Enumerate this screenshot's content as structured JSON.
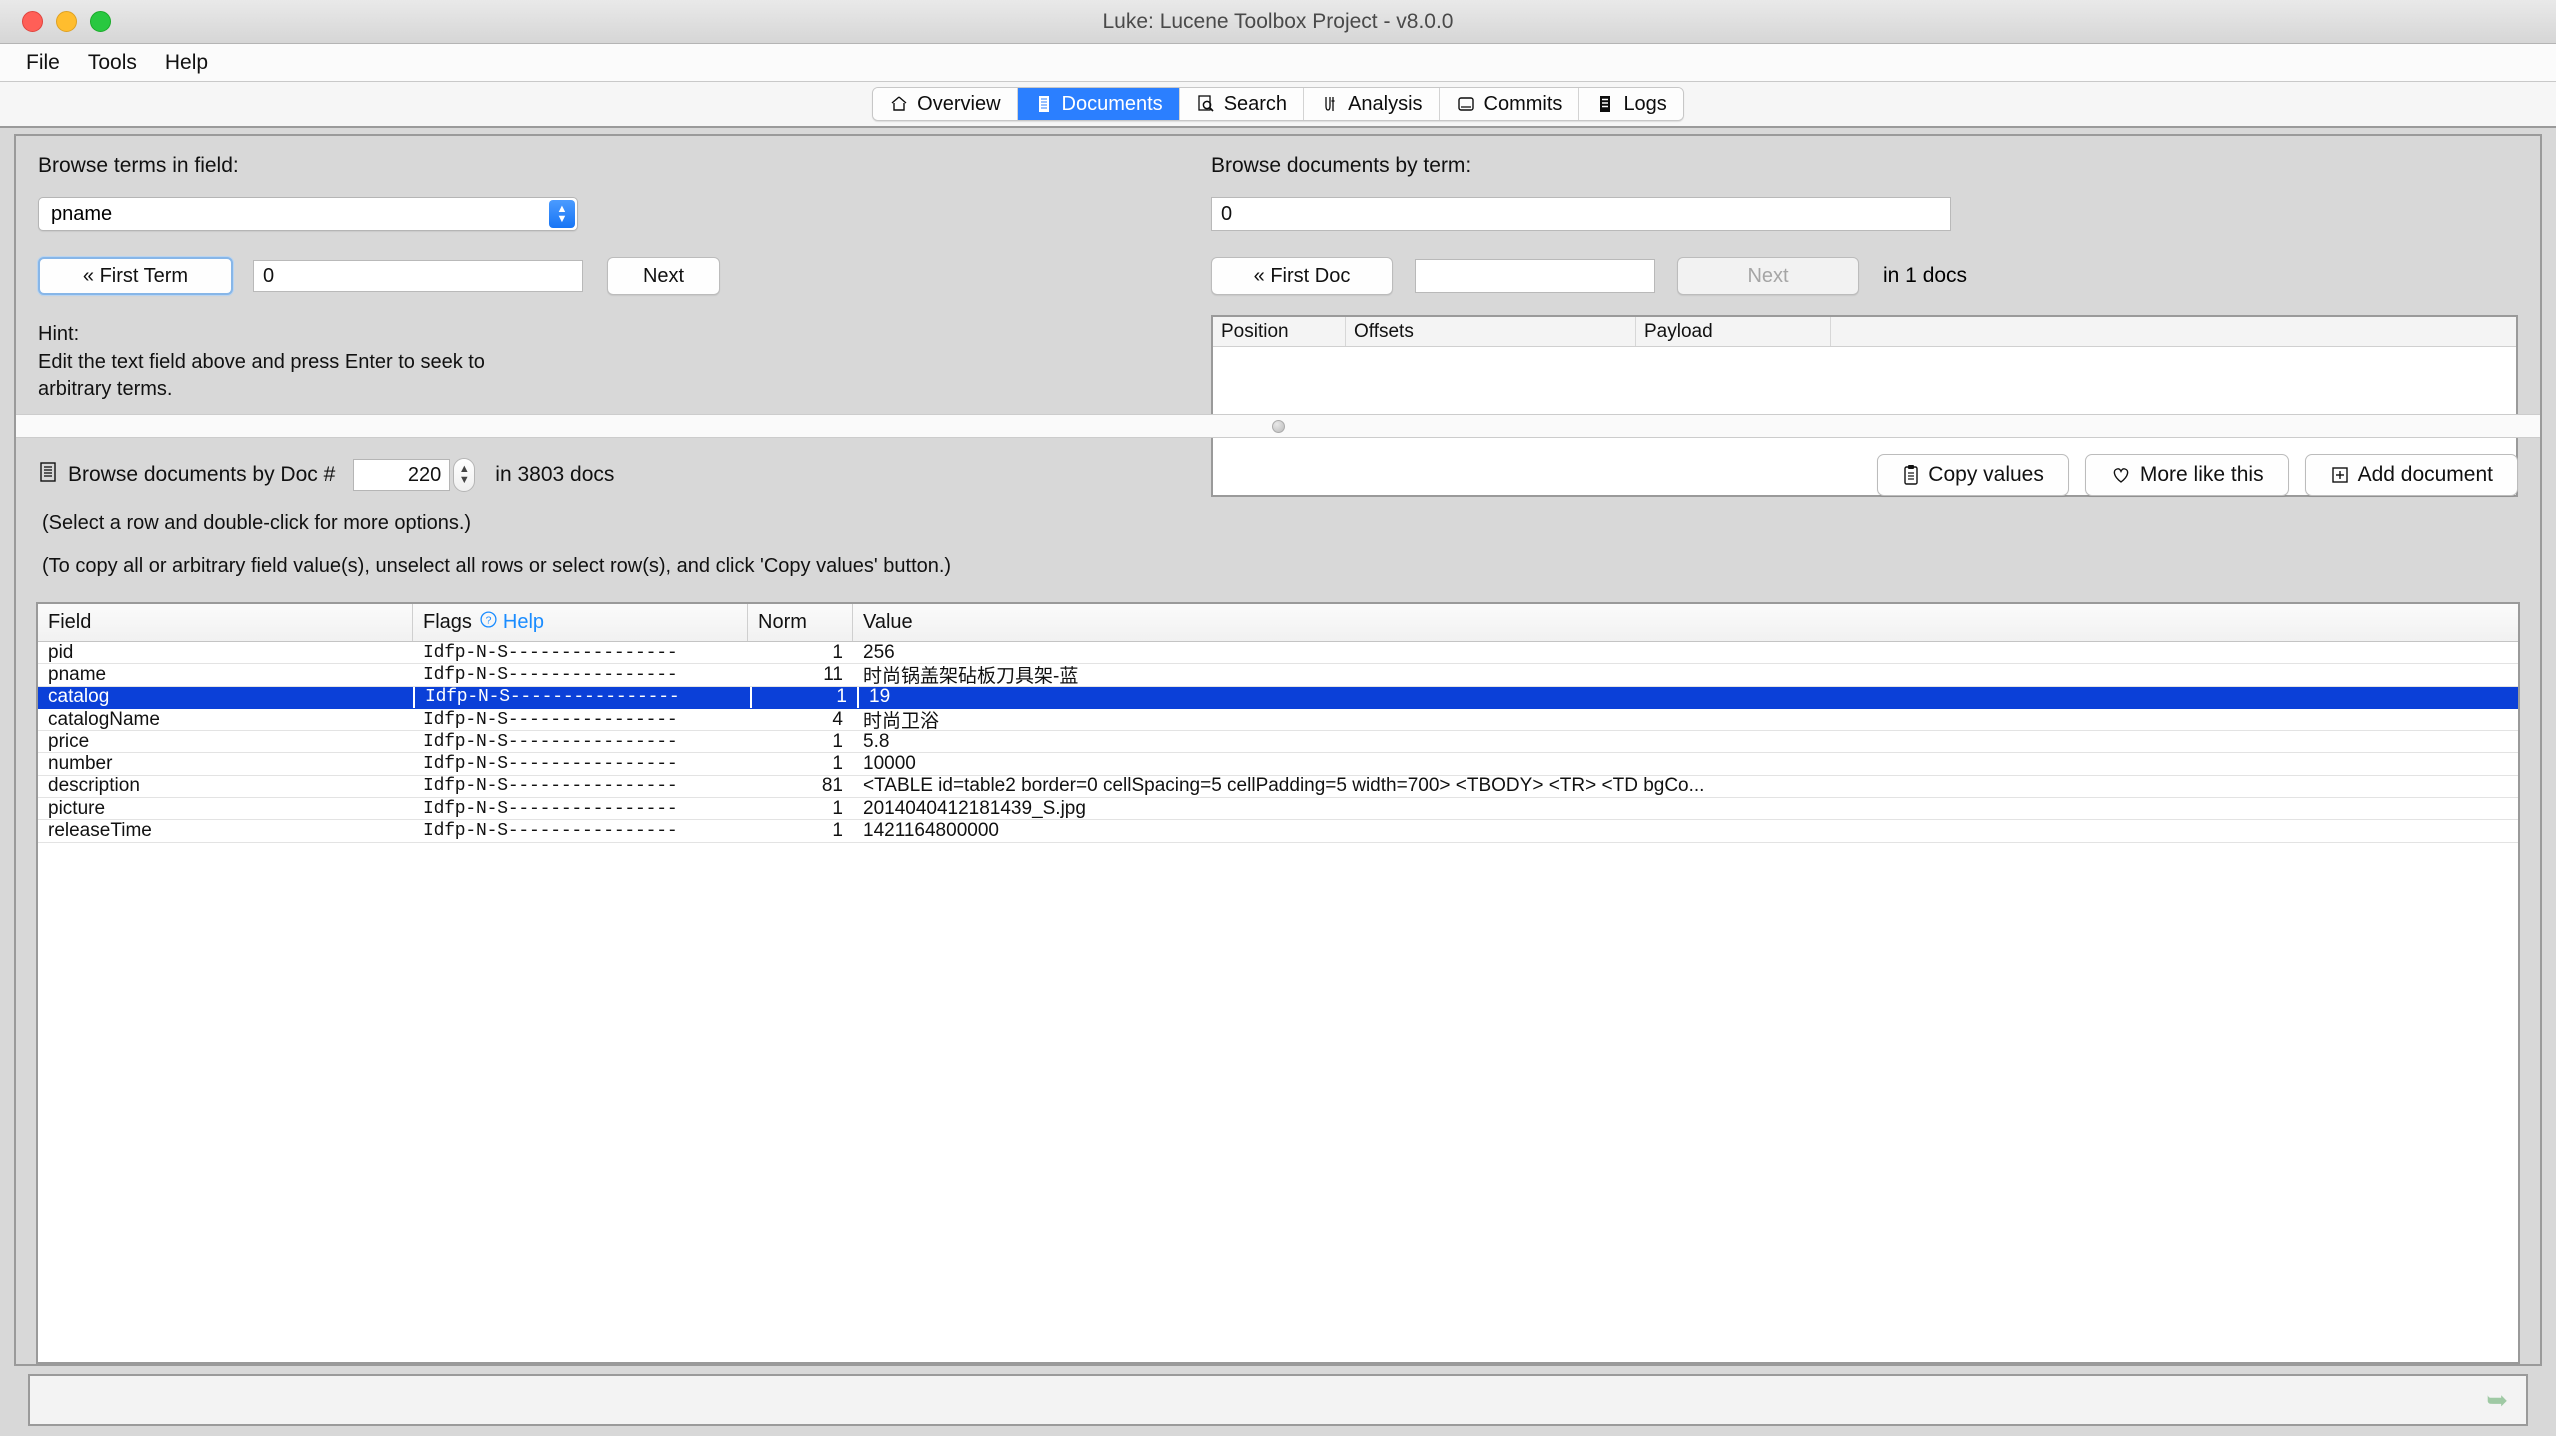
{
  "window": {
    "title": "Luke: Lucene Toolbox Project - v8.0.0",
    "traffic": {
      "close": "close-button",
      "minimize": "minimize-button",
      "zoom": "zoom-button"
    }
  },
  "menubar": {
    "items": [
      {
        "label": "File"
      },
      {
        "label": "Tools"
      },
      {
        "label": "Help"
      }
    ]
  },
  "tabs": [
    {
      "label": "Overview",
      "icon": "home-icon",
      "active": false
    },
    {
      "label": "Documents",
      "icon": "document-icon",
      "active": true
    },
    {
      "label": "Search",
      "icon": "search-icon",
      "active": false
    },
    {
      "label": "Analysis",
      "icon": "analysis-icon",
      "active": false
    },
    {
      "label": "Commits",
      "icon": "commits-icon",
      "active": false
    },
    {
      "label": "Logs",
      "icon": "logs-icon",
      "active": false
    }
  ],
  "browse_terms": {
    "label": "Browse terms in field:",
    "field_value": "pname",
    "first_term_button": "« First Term",
    "term_value": "0",
    "next_button": "Next",
    "hint_title": "Hint:",
    "hint_line1": "Edit the text field above and press Enter to seek to",
    "hint_line2": "arbitrary terms."
  },
  "browse_docs_by_term": {
    "label": "Browse documents by term:",
    "term_value": "0",
    "first_doc_button": "« First Doc",
    "doc_value": "",
    "next_button": "Next",
    "count_text": "in 1 docs",
    "payload_table": {
      "columns": [
        "Position",
        "Offsets",
        "Payload",
        ""
      ],
      "rows": []
    }
  },
  "doc_browser": {
    "label": "Browse documents by Doc #",
    "doc_number": "220",
    "total_text": "in 3803 docs",
    "buttons": [
      {
        "label": "Copy values",
        "icon": "clipboard-icon"
      },
      {
        "label": "More like this",
        "icon": "heart-icon"
      },
      {
        "label": "Add document",
        "icon": "plus-box-icon"
      }
    ]
  },
  "notes": {
    "line1": "(Select a row and double-click for more options.)",
    "line2": "(To copy all or arbitrary field value(s), unselect all rows or select row(s), and click 'Copy values' button.)"
  },
  "field_table": {
    "columns": [
      "Field",
      "Flags",
      "Norm",
      "Value"
    ],
    "help_label": "Help",
    "help_icon": "question-circle-icon",
    "rows": [
      {
        "field": "pid",
        "flags": "Idfp-N-S----------------",
        "norm": "1",
        "value": "256",
        "selected": false
      },
      {
        "field": "pname",
        "flags": "Idfp-N-S----------------",
        "norm": "11",
        "value": "时尚锅盖架砧板刀具架-蓝",
        "selected": false
      },
      {
        "field": "catalog",
        "flags": "Idfp-N-S----------------",
        "norm": "1",
        "value": "19",
        "selected": true
      },
      {
        "field": "catalogName",
        "flags": "Idfp-N-S----------------",
        "norm": "4",
        "value": "时尚卫浴",
        "selected": false
      },
      {
        "field": "price",
        "flags": "Idfp-N-S----------------",
        "norm": "1",
        "value": "5.8",
        "selected": false
      },
      {
        "field": "number",
        "flags": "Idfp-N-S----------------",
        "norm": "1",
        "value": "10000",
        "selected": false
      },
      {
        "field": "description",
        "flags": "Idfp-N-S----------------",
        "norm": "81",
        "value": "<TABLE id=table2 border=0 cellSpacing=5 cellPadding=5 width=700>  <TBODY>  <TR>  <TD bgCo...",
        "selected": false
      },
      {
        "field": "picture",
        "flags": "Idfp-N-S----------------",
        "norm": "1",
        "value": "2014040412181439_S.jpg",
        "selected": false
      },
      {
        "field": "releaseTime",
        "flags": "Idfp-N-S----------------",
        "norm": "1",
        "value": "1421164800000",
        "selected": false
      }
    ]
  },
  "statusbar": {
    "icon": "lucene-logo-icon"
  },
  "colors": {
    "accent_tab": "#2b7fff",
    "selection": "#0b40d8",
    "link": "#1a8cff",
    "window_bg": "#d8d8d8",
    "status_icon": "#9fc9a4"
  }
}
